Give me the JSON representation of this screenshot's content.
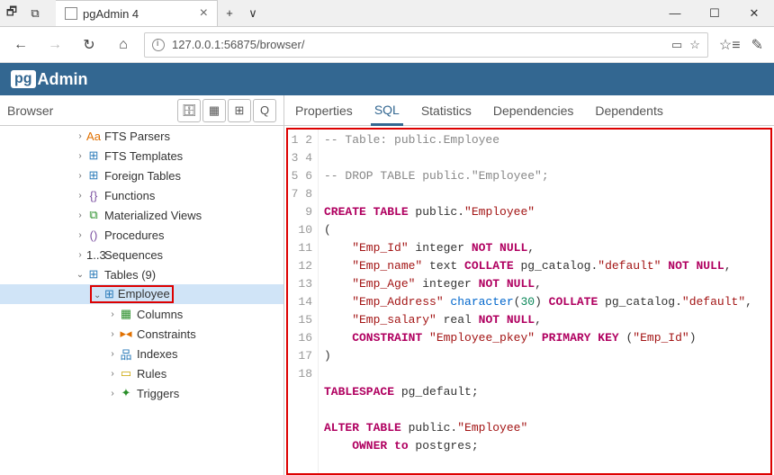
{
  "window": {
    "tab_title": "pgAdmin 4",
    "url": "127.0.0.1:56875/browser/"
  },
  "brand": {
    "pg": "pg",
    "admin": "Admin"
  },
  "sidebar": {
    "title": "Browser",
    "items": [
      {
        "icon": "Aa",
        "label": "FTS Parsers",
        "cls": "ic-orange"
      },
      {
        "icon": "⊞",
        "label": "FTS Templates",
        "cls": "ic-blue"
      },
      {
        "icon": "⊞",
        "label": "Foreign Tables",
        "cls": "ic-blue"
      },
      {
        "icon": "{}",
        "label": "Functions",
        "cls": "ic-purple"
      },
      {
        "icon": "⧉",
        "label": "Materialized Views",
        "cls": "ic-green"
      },
      {
        "icon": "()",
        "label": "Procedures",
        "cls": "ic-purple"
      },
      {
        "icon": "1..3",
        "label": "Sequences",
        "cls": ""
      },
      {
        "icon": "⊞",
        "label": "Tables (9)",
        "cls": "ic-blue"
      }
    ],
    "selected": {
      "icon": "⊞",
      "label": "Employee",
      "cls": "ic-blue"
    },
    "children": [
      {
        "icon": "▦",
        "label": "Columns",
        "cls": "ic-green"
      },
      {
        "icon": "▸◂",
        "label": "Constraints",
        "cls": "ic-orange"
      },
      {
        "icon": "品",
        "label": "Indexes",
        "cls": "ic-blue"
      },
      {
        "icon": "▭",
        "label": "Rules",
        "cls": "ic-yellow"
      },
      {
        "icon": "✦",
        "label": "Triggers",
        "cls": "ic-green"
      }
    ]
  },
  "tabs": {
    "properties": "Properties",
    "sql": "SQL",
    "statistics": "Statistics",
    "dependencies": "Dependencies",
    "dependents": "Dependents"
  },
  "sql_lines": 18,
  "sql": {
    "l1": "-- Table: public.Employee",
    "l3": "-- DROP TABLE public.\"Employee\";",
    "l5_create": "CREATE TABLE",
    "l5_pub": " public.",
    "l5_emp": "\"Employee\"",
    "l6": "(",
    "l7_a": "    \"Emp_Id\"",
    "l7_b": " integer ",
    "l7_c": "NOT NULL",
    "l7_d": ",",
    "l8_a": "    \"Emp_name\"",
    "l8_b": " text ",
    "l8_c": "COLLATE",
    "l8_d": " pg_catalog.",
    "l8_e": "\"default\"",
    "l8_f": " NOT NULL",
    "l8_g": ",",
    "l9_a": "    \"Emp_Age\"",
    "l9_b": " integer ",
    "l9_c": "NOT NULL",
    "l9_d": ",",
    "l10_a": "    \"Emp_Address\"",
    "l10_b": " character",
    "l10_c": "(",
    "l10_d": "30",
    "l10_e": ") ",
    "l10_f": "COLLATE",
    "l10_g": " pg_catalog.",
    "l10_h": "\"default\"",
    "l10_i": ",",
    "l11_a": "    \"Emp_salary\"",
    "l11_b": " real ",
    "l11_c": "NOT NULL",
    "l11_d": ",",
    "l12_a": "    CONSTRAINT ",
    "l12_b": "\"Employee_pkey\"",
    "l12_c": " PRIMARY KEY ",
    "l12_d": "(",
    "l12_e": "\"Emp_Id\"",
    "l12_f": ")",
    "l13": ")",
    "l15_a": "TABLESPACE",
    "l15_b": " pg_default;",
    "l17_a": "ALTER TABLE",
    "l17_b": " public.",
    "l17_c": "\"Employee\"",
    "l18_a": "    OWNER to",
    "l18_b": " postgres;"
  }
}
